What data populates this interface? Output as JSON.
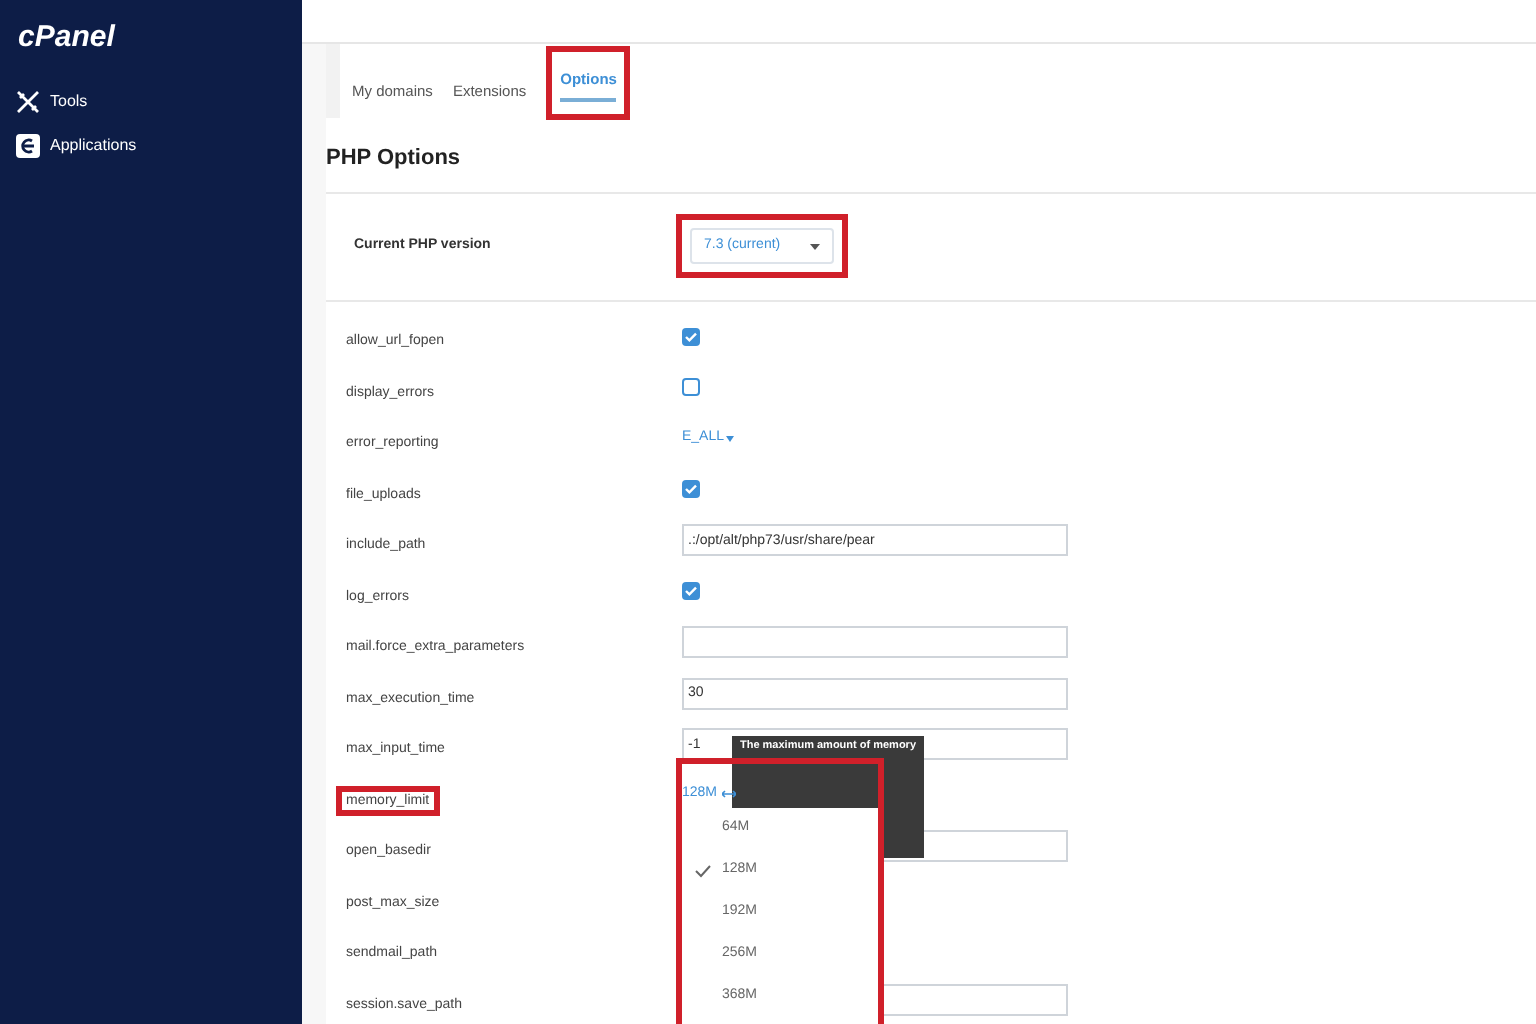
{
  "sidebar": {
    "logo": "cPanel",
    "items": [
      {
        "kind": "tools",
        "label": "Tools"
      },
      {
        "kind": "applications",
        "label": "Applications"
      }
    ]
  },
  "tabs": [
    {
      "label": "My domains",
      "selected": false
    },
    {
      "label": "Extensions",
      "selected": false
    },
    {
      "label": "Options",
      "selected": true
    }
  ],
  "heading": "PHP Options",
  "php_version": {
    "label": "Current PHP version",
    "value": "7.3 (current)"
  },
  "options": [
    {
      "name": "allow_url_fopen",
      "kind": "checkbox",
      "checked": true
    },
    {
      "name": "display_errors",
      "kind": "checkbox",
      "checked": false
    },
    {
      "name": "error_reporting",
      "kind": "select",
      "value": "E_ALL"
    },
    {
      "name": "file_uploads",
      "kind": "checkbox",
      "checked": true
    },
    {
      "name": "include_path",
      "kind": "text",
      "value": ".:/opt/alt/php73/usr/share/pear"
    },
    {
      "name": "log_errors",
      "kind": "checkbox",
      "checked": true
    },
    {
      "name": "mail.force_extra_parameters",
      "kind": "text"
    },
    {
      "name": "max_execution_time",
      "kind": "text",
      "value": "30"
    },
    {
      "name": "max_input_time",
      "kind": "text",
      "value": "-1"
    },
    {
      "name": "memory_limit",
      "kind": "dropdown",
      "value": "128M",
      "highlighted": true
    },
    {
      "name": "open_basedir",
      "kind": "text"
    },
    {
      "name": "post_max_size",
      "kind": "hidden"
    },
    {
      "name": "sendmail_path",
      "kind": "hidden"
    },
    {
      "name": "session.save_path",
      "kind": "text"
    }
  ],
  "tooltip": "The maximum amount of memory",
  "memory_menu": [
    {
      "label": "64M",
      "selected": false
    },
    {
      "label": "128M",
      "selected": true
    },
    {
      "label": "192M",
      "selected": false
    },
    {
      "label": "256M",
      "selected": false
    },
    {
      "label": "368M",
      "selected": false
    }
  ]
}
